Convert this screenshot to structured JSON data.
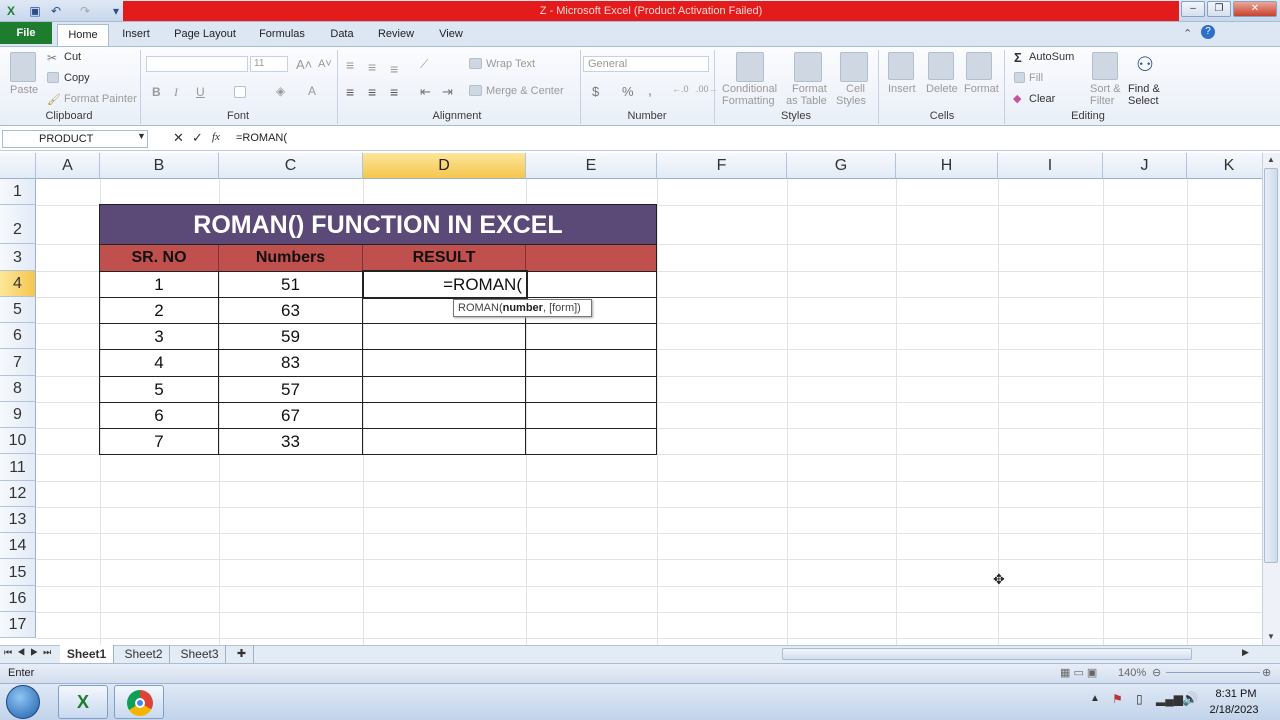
{
  "window": {
    "title": "Z - Microsoft Excel (Product Activation Failed)"
  },
  "tabs": [
    "File",
    "Home",
    "Insert",
    "Page Layout",
    "Formulas",
    "Data",
    "Review",
    "View"
  ],
  "ribbon": {
    "clipboard": {
      "paste": "Paste",
      "cut": "Cut",
      "copy": "Copy",
      "format_painter": "Format Painter",
      "label": "Clipboard"
    },
    "font": {
      "size": "11",
      "label": "Font",
      "bold": "B",
      "italic": "I",
      "underline": "U"
    },
    "alignment": {
      "wrap": "Wrap Text",
      "merge": "Merge & Center",
      "label": "Alignment"
    },
    "number": {
      "format": "General",
      "currency": "$",
      "percent": "%",
      "comma": ",",
      "label": "Number"
    },
    "styles": {
      "conditional": "Conditional",
      "conditional2": "Formatting",
      "format_table": "Format",
      "format_table2": "as Table",
      "cell_styles": "Cell",
      "cell_styles2": "Styles",
      "label": "Styles"
    },
    "cells": {
      "insert": "Insert",
      "delete": "Delete",
      "format": "Format",
      "label": "Cells"
    },
    "editing": {
      "autosum": "AutoSum",
      "fill": "Fill",
      "clear": "Clear",
      "sort": "Sort &",
      "sort2": "Filter",
      "find": "Find &",
      "find2": "Select",
      "label": "Editing"
    }
  },
  "formula_bar": {
    "name_box": "PRODUCT",
    "fx": "fx",
    "formula": "=ROMAN("
  },
  "columns": [
    "A",
    "B",
    "C",
    "D",
    "E",
    "F",
    "G",
    "H",
    "I",
    "J",
    "K"
  ],
  "rows": [
    "1",
    "2",
    "3",
    "4",
    "5",
    "6",
    "7",
    "8",
    "9",
    "10",
    "11",
    "12",
    "13",
    "14",
    "15",
    "16",
    "17"
  ],
  "table": {
    "title": "ROMAN() FUNCTION IN EXCEL",
    "headers": [
      "SR. NO",
      "Numbers",
      "RESULT",
      ""
    ],
    "sr": [
      "1",
      "2",
      "3",
      "4",
      "5",
      "6",
      "7"
    ],
    "numbers": [
      "51",
      "63",
      "59",
      "83",
      "57",
      "67",
      "33"
    ],
    "active_entry": "=ROMAN("
  },
  "tooltip": {
    "fn": "ROMAN(",
    "arg": "number",
    "rest": ", [form])"
  },
  "sheets": [
    "Sheet1",
    "Sheet2",
    "Sheet3"
  ],
  "status": {
    "mode": "Enter",
    "zoom": "140%"
  },
  "taskbar": {
    "time": "8:31 PM",
    "date": "2/18/2023"
  }
}
